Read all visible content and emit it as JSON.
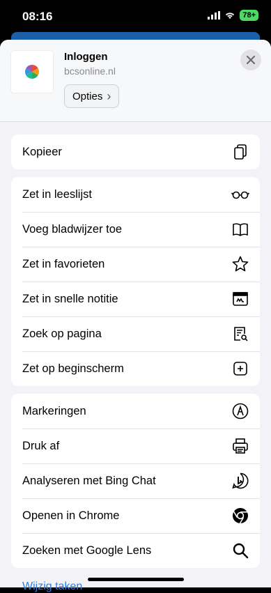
{
  "status_bar": {
    "time": "08:16",
    "battery": "78+"
  },
  "sheet_header": {
    "title": "Inloggen",
    "url": "bcsonline.nl",
    "options_label": "Opties",
    "options_chevron": "›"
  },
  "groups": [
    {
      "items": [
        {
          "label": "Kopieer",
          "icon": "copy-icon"
        }
      ]
    },
    {
      "items": [
        {
          "label": "Zet in leeslijst",
          "icon": "glasses-icon"
        },
        {
          "label": "Voeg bladwijzer toe",
          "icon": "book-icon"
        },
        {
          "label": "Zet in favorieten",
          "icon": "star-icon"
        },
        {
          "label": "Zet in snelle notitie",
          "icon": "quick-note-icon"
        },
        {
          "label": "Zoek op pagina",
          "icon": "find-on-page-icon"
        },
        {
          "label": "Zet op beginscherm",
          "icon": "add-square-icon"
        }
      ]
    },
    {
      "items": [
        {
          "label": "Markeringen",
          "icon": "markup-icon"
        },
        {
          "label": "Druk af",
          "icon": "printer-icon"
        },
        {
          "label": "Analyseren met Bing Chat",
          "icon": "bing-icon"
        },
        {
          "label": "Openen in Chrome",
          "icon": "chrome-icon"
        },
        {
          "label": "Zoeken met Google Lens",
          "icon": "search-icon"
        }
      ]
    }
  ],
  "bottom_link": "Wijzig taken",
  "colors": {
    "accent": "#2f7de1",
    "sheet_bg": "#f2f2f7",
    "battery_green": "#4cd964"
  }
}
